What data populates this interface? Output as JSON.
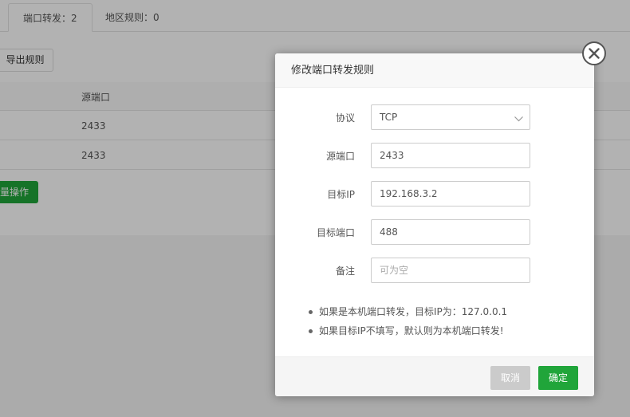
{
  "background": {
    "tabs": [
      {
        "label": "端口转发：2"
      },
      {
        "label": "地区规则：0"
      }
    ],
    "export_label": "导出规则",
    "table": {
      "header": "源端口",
      "rows": [
        "2433",
        "2433"
      ]
    },
    "batch_label": "量操作"
  },
  "modal": {
    "title": "修改端口转发规则",
    "fields": {
      "protocol": {
        "label": "协议",
        "value": "TCP"
      },
      "source_port": {
        "label": "源端口",
        "value": "2433"
      },
      "target_ip": {
        "label": "目标IP",
        "value": "192.168.3.2"
      },
      "target_port": {
        "label": "目标端口",
        "value": "488"
      },
      "remark": {
        "label": "备注",
        "value": "",
        "placeholder": "可为空"
      }
    },
    "tips": [
      "如果是本机端口转发，目标IP为：127.0.0.1",
      "如果目标IP不填写，默认则为本机端口转发!"
    ],
    "cancel_label": "取消",
    "ok_label": "确定"
  },
  "colors": {
    "accent": "#20a53a",
    "cancel": "#cbcbcb"
  },
  "icons": {
    "close": "close-icon",
    "dropdown": "chevron-down-icon"
  }
}
